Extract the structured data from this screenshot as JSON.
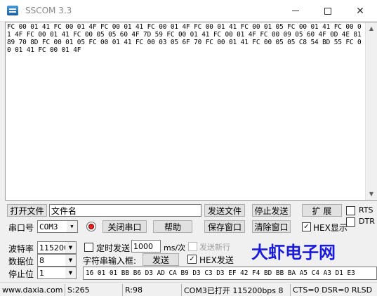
{
  "window": {
    "title": "SSCOM 3.3"
  },
  "receive": {
    "text": "FC 00 01 41 FC 00 01 4F FC 00 01 41 FC 00 01 4F FC 00 01 41 FC 00 01 05 FC 00 01 41 FC 00 01 4F FC 00 01 41 FC 00 05 05 60 4F 7D 59 FC 00 01 41 FC 00 01 4F FC 00 09 05 60 4F 0D 4E 81 89 70 8D FC 00 01 05 FC 00 01 41 FC 00 03 05 6F 70 FC 00 01 41 FC 00 05 05 C8 54 BD 55 FC 00 01 41 FC 00 01 4F"
  },
  "file_row": {
    "open_file_label": "打开文件",
    "filename_value": "文件名",
    "send_file_label": "发送文件",
    "stop_send_label": "停止发送",
    "expand_label": "扩 展",
    "rts_label": "RTS",
    "dtr_label": "DTR"
  },
  "port_row": {
    "port_label": "串口号",
    "port_value": "COM3",
    "close_port_label": "关闭串口",
    "help_label": "帮助",
    "save_window_label": "保存窗口",
    "clear_window_label": "清除窗口",
    "hex_display_label": "HEX显示",
    "hex_display_checked": "✓"
  },
  "settings": {
    "baud_label": "波特率",
    "baud_value": "115200",
    "data_bits_label": "数据位",
    "data_bits_value": "8",
    "stop_bits_label": "停止位",
    "stop_bits_value": "1",
    "timed_send_label": "定时发送",
    "interval_value": "1000",
    "interval_unit": "ms/次",
    "send_newline_label": "发送新行",
    "string_input_label": "字符串输入框:",
    "send_label": "发送",
    "hex_send_label": "HEX发送",
    "hex_send_checked": "✓",
    "send_value": "16 01 01 BB B6 D3 AD CA B9 D3 C3 D3 EF 42 F4 BD BB BA A5 C4 A3 D1 E3"
  },
  "brand": {
    "text": "大虾电子网"
  },
  "status": {
    "website": "www.daxia.com",
    "sent": "S:265",
    "received": "R:98",
    "port_state": "COM3已打开  115200bps  8",
    "lines": "CTS=0 DSR=0 RLSD"
  },
  "colors": {
    "brand": "#1a1adc",
    "close_port_indicator": "#e8201a"
  }
}
